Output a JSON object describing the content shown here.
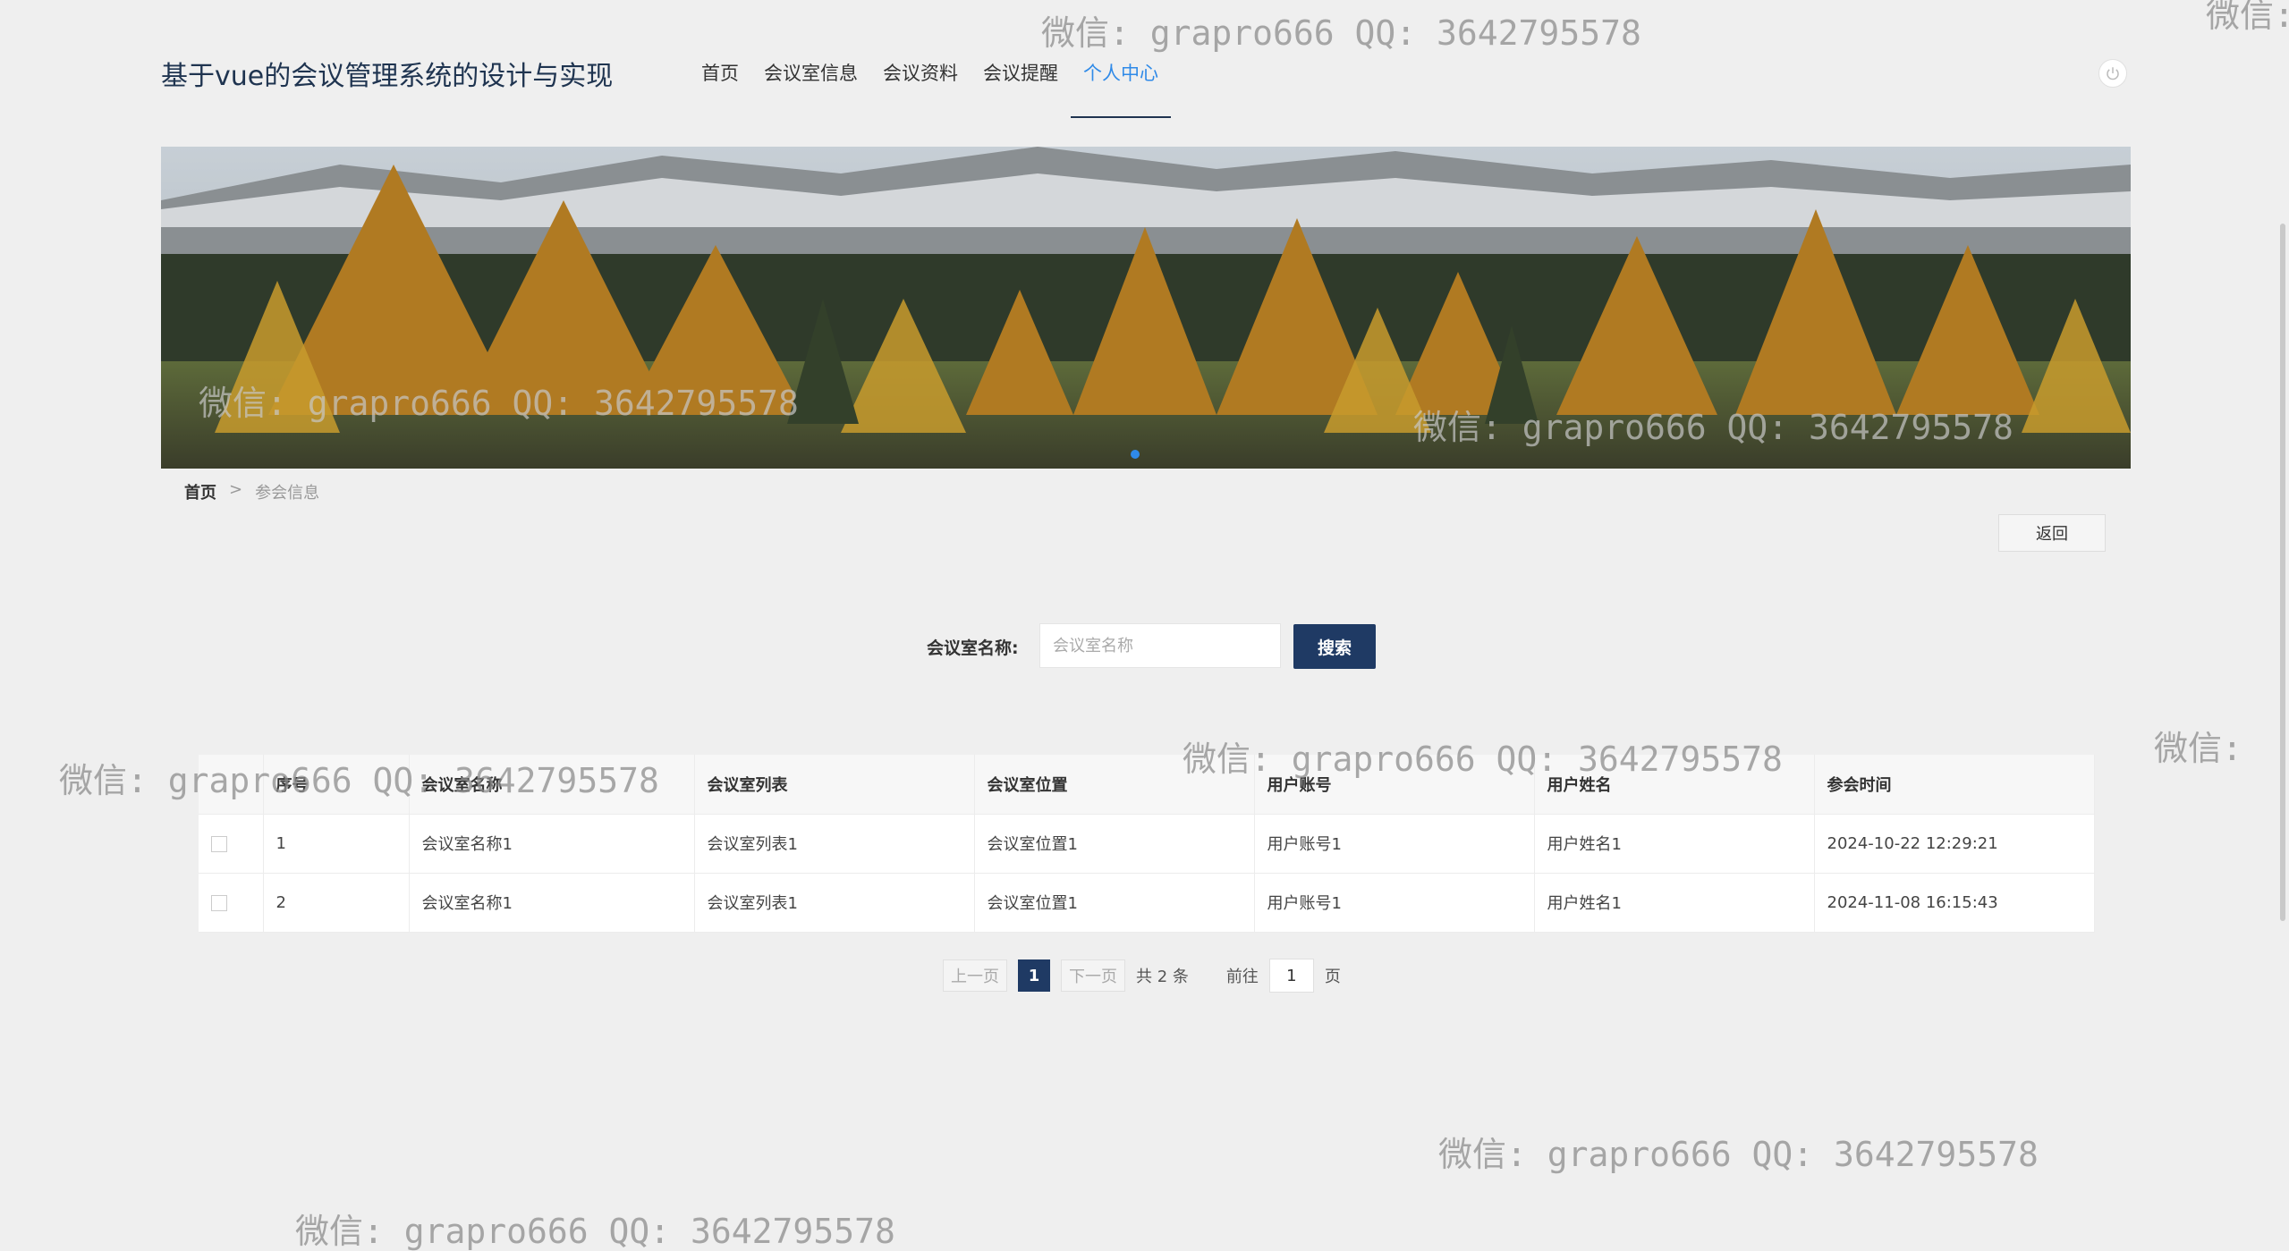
{
  "header": {
    "title": "基于vue的会议管理系统的设计与实现",
    "nav": [
      {
        "label": "首页"
      },
      {
        "label": "会议室信息"
      },
      {
        "label": "会议资料"
      },
      {
        "label": "会议提醒"
      },
      {
        "label": "个人中心"
      }
    ],
    "active_nav": "个人中心"
  },
  "breadcrumb": {
    "home": "首页",
    "separator": ">",
    "current": "参会信息"
  },
  "actions": {
    "back_label": "返回"
  },
  "search": {
    "label": "会议室名称:",
    "placeholder": "会议室名称",
    "button_label": "搜索"
  },
  "table": {
    "headers": [
      "序号",
      "会议室名称",
      "会议室列表",
      "会议室位置",
      "用户账号",
      "用户姓名",
      "参会时间"
    ],
    "rows": [
      [
        "1",
        "会议室名称1",
        "会议室列表1",
        "会议室位置1",
        "用户账号1",
        "用户姓名1",
        "2024-10-22 12:29:21"
      ],
      [
        "2",
        "会议室名称1",
        "会议室列表1",
        "会议室位置1",
        "用户账号1",
        "用户姓名1",
        "2024-11-08 16:15:43"
      ]
    ]
  },
  "pagination": {
    "prev_label": "上一页",
    "current_page": "1",
    "next_label": "下一页",
    "total_text": "共 2 条",
    "goto_label": "前往",
    "goto_value": "1",
    "page_suffix": "页"
  },
  "watermark": {
    "text": "微信: grapro666 QQ: 3642795578",
    "partial": "微信:"
  },
  "colors": {
    "accent": "#2f8ae8",
    "primary_dark": "#1f3a64",
    "title": "#1f3450"
  }
}
